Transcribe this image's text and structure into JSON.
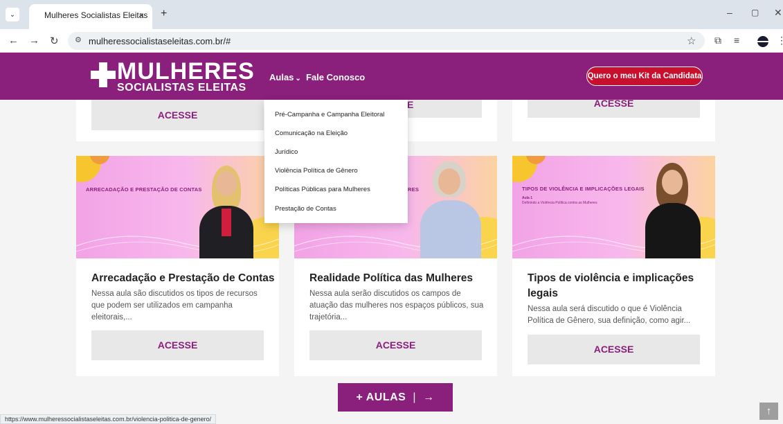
{
  "browser": {
    "tab_title": "Mulheres Socialistas Eleitas",
    "tab_close": "×",
    "new_tab": "+",
    "url": "mulheressocialistaseleitas.com.br/#",
    "status_url": "https://www.mulheressocialistaseleitas.com.br/violencia-politica-de-genero/"
  },
  "header": {
    "logo_line1": "MULHERES",
    "logo_line2": "SOCIALISTAS ELEITAS",
    "nav_aulas": "Aulas",
    "nav_fale": "Fale Conosco",
    "kit_button": "Quero o meu Kit da Candidata"
  },
  "dropdown": {
    "items": [
      "Pré-Campanha e Campanha Eleitoral",
      "Comunicação na Eleição",
      "Jurídico",
      "Violência Política de Gênero",
      "Políticas Públicas para Mulheres",
      "Prestação de Contas"
    ]
  },
  "top_row": {
    "acesse_1": "ACESSE",
    "acesse_2": "E",
    "acesse_3": "ACESSE"
  },
  "cards": [
    {
      "image_title": "ARRECADAÇÃO E PRESTAÇÃO DE CONTAS",
      "title": "Arrecadação e Prestação de Contas",
      "description": "Nessa aula são discutidos os tipos de recursos que podem ser utilizados em campanha eleitorais,...",
      "button": "ACESSE"
    },
    {
      "image_title": "RES",
      "title": "Realidade Política das Mulheres",
      "description": "Nessa aula serão discutidos os campos de atuação das mulheres nos espaços públicos, sua trajetória...",
      "button": "ACESSE"
    },
    {
      "image_title": "TIPOS DE VIOLÊNCIA E IMPLICAÇÕES LEGAIS",
      "image_sub1": "Aula 1",
      "image_sub2": "Definindo a Violência Política contra as Mulheres",
      "title_line1": "Tipos de violência e implicações",
      "title_line2": "legais",
      "description": "Nessa aula será discutido o que é Violência Política de Gênero, sua definição, como agir...",
      "button": "ACESSE"
    }
  ],
  "more_button": {
    "label": "+ AULAS",
    "separator": "|",
    "arrow": "→"
  },
  "colors": {
    "brand": "#8b1f7c",
    "kit_button": "#c8102e"
  }
}
